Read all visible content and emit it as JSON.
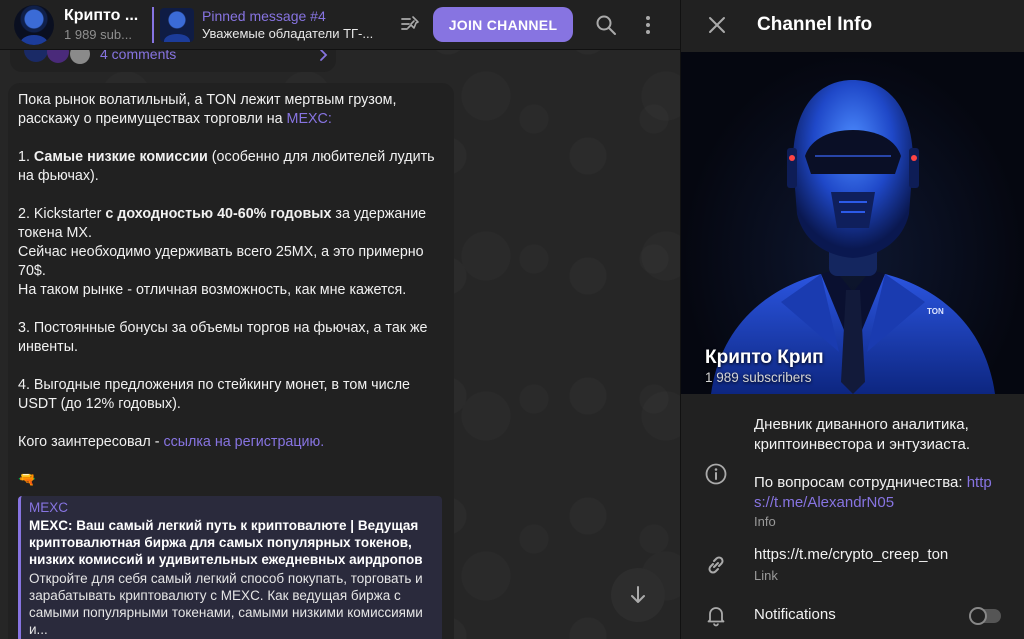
{
  "header": {
    "channel_title": "Крипто ...",
    "channel_subs": "1 989 sub...",
    "pinned_title": "Pinned message #4",
    "pinned_body": "Уважемые обладатели ТГ-...",
    "join_label": "JOIN CHANNEL"
  },
  "prev_message": {
    "comments": "4 comments"
  },
  "message": {
    "p1a": "Пока рынок волатильный, а TON лежит мертвым грузом, расскажу о преимуществах торговли на ",
    "p1_link": "MEXC:",
    "i1_num": "1. ",
    "i1_bold": "Самые низкие комиссии",
    "i1_rest": " (особенно для любителей лудить на фьючах).",
    "i2_num": "2. Kickstarter ",
    "i2_bold": "с доходностью 40-60% годовых",
    "i2_rest": " за удержание токена MX.",
    "i2_line2": "Сейчас необходимо удерживать всего 25MX, а это примерно 70$.",
    "i2_line3": "На таком рынке - отличная возможность, как мне кажется.",
    "i3": "3. Постоянные бонусы за объемы торгов на фьючах, а так же инвенты.",
    "i4": "4. Выгодные предложения по стейкингу монет, в том числе USDT (до 12% годовых).",
    "cta_text": "Кого заинтересовал - ",
    "cta_link": "ссылка на регистрацию.",
    "emoji": "🔫"
  },
  "preview": {
    "site": "MEXC",
    "title": "MEXC: Ваш самый легкий путь к криптовалюте | Ведущая криптовалютная биржа для самых популярных токенов, низких комиссий и удивительных ежедневных аирдропов",
    "description": "Откройте для себя самый легкий способ покупать, торговать и зарабатывать криптовалюту с MEXC. Как ведущая биржа с самыми популярными токенами, самыми низкими комиссиями и..."
  },
  "panel": {
    "title": "Channel Info",
    "channel_name": "Крипто Крип",
    "subscribers": "1 989 subscribers",
    "cover_badge": "TON",
    "info_line1": "Дневник диванного аналитика, криптоинвестора и энтузиаста.",
    "info_line2_text": "По вопросам сотрудничества: ",
    "info_line2_link": "https://t.me/AlexandrN05",
    "info_label": "Info",
    "link_value": "https://t.me/crypto_creep_ton",
    "link_label": "Link",
    "notifications_label": "Notifications",
    "notifications_on": false
  },
  "colors": {
    "accent": "#8774e1",
    "background": "#212121",
    "chat_background": "#262626"
  },
  "icons": [
    "pinned-list-icon",
    "search-icon",
    "more-vertical-icon",
    "close-icon",
    "info-icon",
    "link-icon",
    "bell-icon",
    "arrow-down-icon"
  ]
}
